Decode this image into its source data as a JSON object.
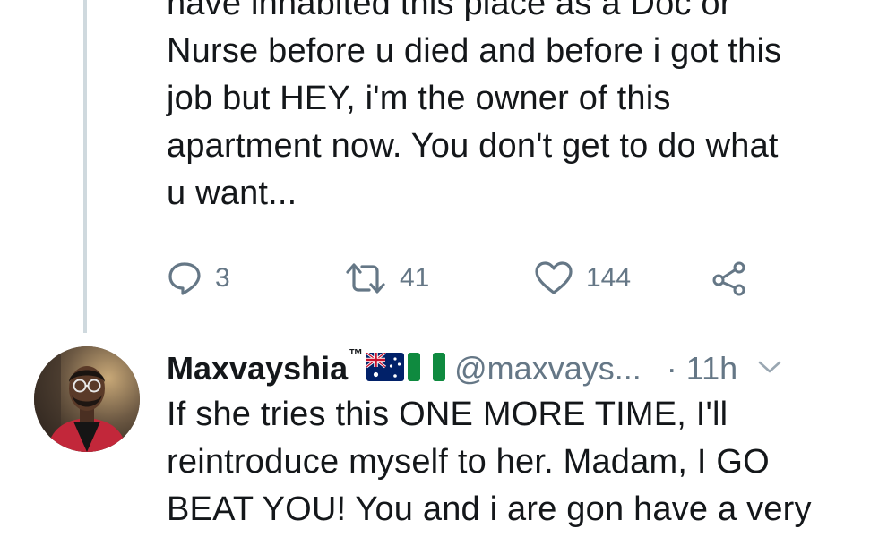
{
  "previous_tweet": {
    "lines": [
      "have inhabited this place as a Doc or",
      "Nurse before u died and before i got this",
      "job but HEY, i'm the owner of this",
      "apartment now. You don't get to do what",
      "u want..."
    ],
    "actions": {
      "reply_icon": "reply-icon",
      "reply_count": "3",
      "retweet_icon": "retweet-icon",
      "retweet_count": "41",
      "like_icon": "heart-icon",
      "like_count": "144",
      "share_icon": "share-icon"
    }
  },
  "reply_tweet": {
    "display_name": "Maxvayshia",
    "trademark": "™",
    "flags": [
      "australia-flag",
      "nigeria-flag"
    ],
    "handle": "@maxvays...",
    "time": "· 11h",
    "menu_icon": "chevron-down-icon",
    "lines": [
      "If she tries this ONE MORE TIME, I'll",
      "reintroduce myself to her. Madam, I GO",
      "BEAT YOU! You and i are gon have a very"
    ]
  },
  "colors": {
    "text": "#14171a",
    "secondary": "#657786",
    "thread_line": "#cfd9de"
  }
}
